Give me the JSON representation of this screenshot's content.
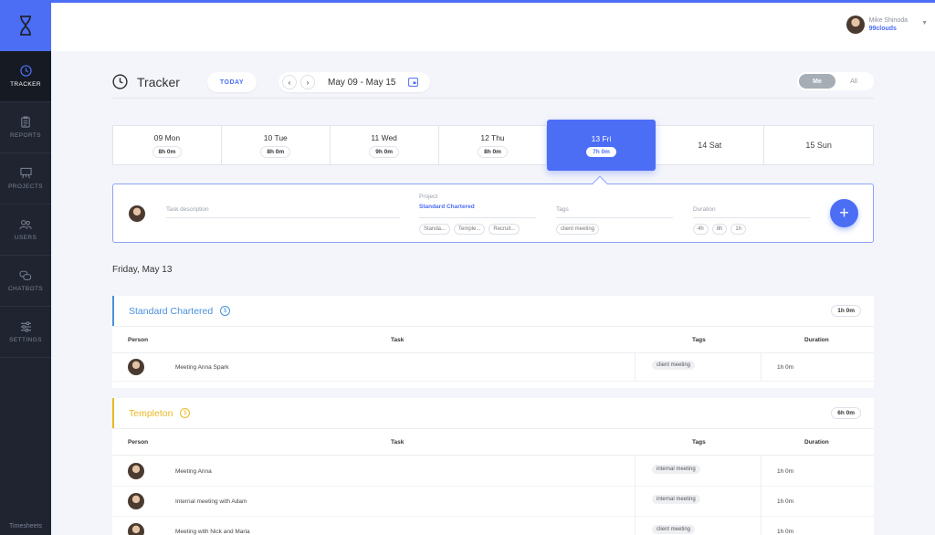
{
  "sidebar": {
    "items": [
      {
        "label": "TRACKER",
        "icon": "clock-icon"
      },
      {
        "label": "REPORTS",
        "icon": "clipboard-icon"
      },
      {
        "label": "PROJECTS",
        "icon": "easel-icon"
      },
      {
        "label": "USERS",
        "icon": "users-icon"
      },
      {
        "label": "CHATBOTS",
        "icon": "chat-icon"
      },
      {
        "label": "SETTINGS",
        "icon": "sliders-icon"
      }
    ],
    "footer": "Timesheets"
  },
  "header": {
    "user_name": "Mike Shinoda",
    "org": "99clouds",
    "caret": "▼"
  },
  "tracker": {
    "title": "Tracker",
    "today_label": "TODAY",
    "prev": "‹",
    "next": "›",
    "date_range": "May 09 - May 15",
    "toggle_me": "Me",
    "toggle_all": "All"
  },
  "week": {
    "days": [
      {
        "name": "09 Mon",
        "hours": "8h 0m"
      },
      {
        "name": "10 Tue",
        "hours": "8h 0m"
      },
      {
        "name": "11 Wed",
        "hours": "9h 0m"
      },
      {
        "name": "12 Thu",
        "hours": "8h 0m"
      },
      {
        "name": "13 Fri",
        "hours": "7h 0m"
      },
      {
        "name": "14 Sat",
        "hours": ""
      },
      {
        "name": "15 Sun",
        "hours": ""
      }
    ]
  },
  "entry": {
    "task_placeholder": "Task description",
    "project_label": "Project",
    "project_value": "Standard Chartered",
    "project_chips": [
      "Standa...",
      "Temple...",
      "Recruit..."
    ],
    "tags_label": "Tags",
    "tag_chips": [
      "client meeting"
    ],
    "duration_label": "Duration",
    "duration_chips": [
      "4h",
      "8h",
      "1h"
    ],
    "add": "+"
  },
  "day_heading": "Friday, May 13",
  "columns": {
    "person": "Person",
    "task": "Task",
    "tags": "Tags",
    "duration": "Duration"
  },
  "groups": [
    {
      "name": "Standard Chartered",
      "color": "#4a90d9",
      "coin": "$",
      "total": "1h 0m",
      "rows": [
        {
          "task": "Meeting Anna Spark",
          "tag": "client meeting",
          "duration": "1h 0m"
        }
      ]
    },
    {
      "name": "Templeton",
      "color": "#e8b923",
      "coin": "$",
      "total": "6h 0m",
      "rows": [
        {
          "task": "Meeting Anna",
          "tag": "internal meeting",
          "duration": "1h 0m"
        },
        {
          "task": "Internal meeting with Adam",
          "tag": "internal meeting",
          "duration": "1h 0m"
        },
        {
          "task": "Meeting with Nick and Maria",
          "tag": "client meeting",
          "duration": "1h 0m"
        }
      ]
    }
  ],
  "colors": {
    "accent": "#4c6ef5",
    "sidebar": "#1f2430",
    "background": "#f4f5fb"
  }
}
